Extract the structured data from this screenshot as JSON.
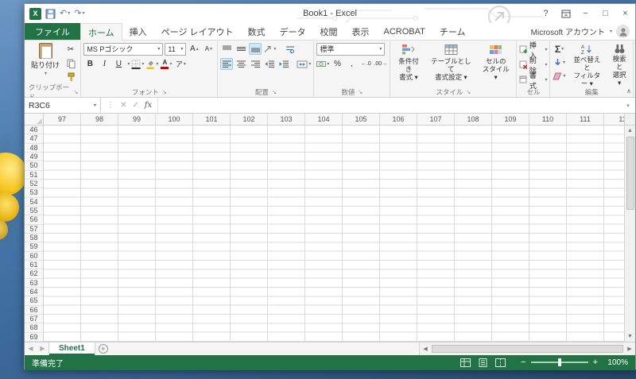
{
  "title_bar": {
    "title": "Book1 - Excel",
    "help_label": "?",
    "minimize_label": "−",
    "maximize_label": "□",
    "close_label": "×",
    "undo_glyph": "↶",
    "redo_glyph": "↷"
  },
  "tabs": {
    "file": "ファイル",
    "active": "ホーム",
    "items": [
      "ホーム",
      "挿入",
      "ページ レイアウト",
      "数式",
      "データ",
      "校閲",
      "表示",
      "ACROBAT",
      "チーム"
    ],
    "account": "Microsoft アカウント"
  },
  "ribbon": {
    "clipboard": {
      "label": "クリップボード",
      "paste_label": "貼り付け"
    },
    "font": {
      "label": "フォント",
      "font_name": "MS Pゴシック",
      "font_size": "11",
      "bold": "B",
      "italic": "I",
      "underline": "U",
      "grow": "A",
      "shrink": "A",
      "color": "A",
      "ruby": "ア"
    },
    "alignment": {
      "label": "配置"
    },
    "number": {
      "label": "数値",
      "format": "標準",
      "percent": "%",
      "comma": ",",
      "inc_decimal": "←.0",
      "dec_decimal": ".00→"
    },
    "styles": {
      "label": "スタイル",
      "conditional": "条件付き\n書式 ▾",
      "table": "テーブルとして\n書式設定 ▾",
      "cell": "セルの\nスタイル ▾"
    },
    "cells": {
      "label": "セル",
      "insert": "挿入",
      "delete": "削除",
      "format": "書式"
    },
    "editing": {
      "label": "編集",
      "autosum": "Σ",
      "sort": "並べ替えと\nフィルター ▾",
      "find": "検索と\n選択 ▾"
    }
  },
  "formula_bar": {
    "name_box": "R3C6",
    "cancel": "✕",
    "enter": "✓",
    "fx": "fx"
  },
  "grid": {
    "columns": [
      "97",
      "98",
      "99",
      "100",
      "101",
      "102",
      "103",
      "104",
      "105",
      "106",
      "107",
      "108",
      "109",
      "110",
      "111",
      "11"
    ],
    "rows": [
      "46",
      "47",
      "48",
      "49",
      "50",
      "51",
      "52",
      "53",
      "54",
      "55",
      "56",
      "57",
      "58",
      "59",
      "60",
      "61",
      "62",
      "63",
      "64",
      "65",
      "66",
      "67",
      "68",
      "69"
    ]
  },
  "sheet_bar": {
    "active_tab": "Sheet1",
    "add": "+"
  },
  "status_bar": {
    "mode": "準備完了",
    "zoom": "100%"
  }
}
